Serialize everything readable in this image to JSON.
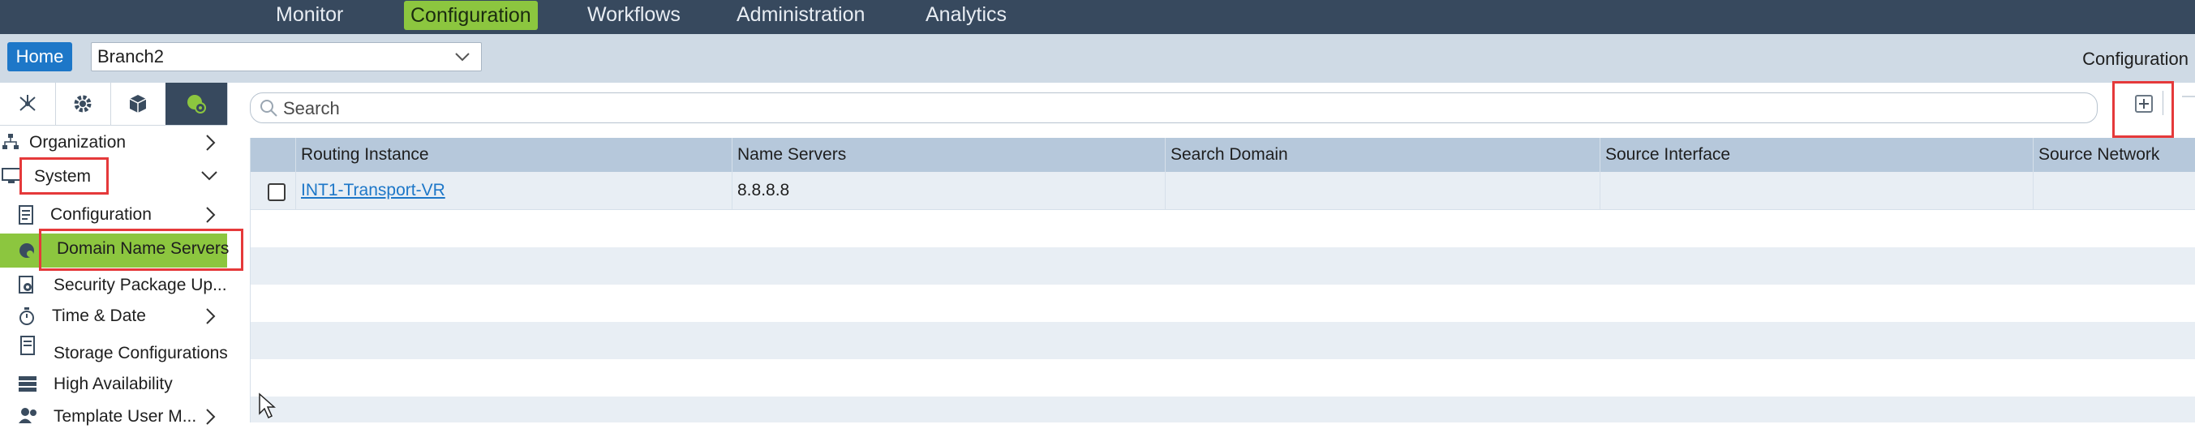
{
  "nav": {
    "items": [
      {
        "label": "Monitor",
        "active": false
      },
      {
        "label": "Configuration",
        "active": true
      },
      {
        "label": "Workflows",
        "active": false
      },
      {
        "label": "Administration",
        "active": false
      },
      {
        "label": "Analytics",
        "active": false
      }
    ]
  },
  "subheader": {
    "home_label": "Home",
    "branch_value": "Branch2",
    "context_label": "Configuration"
  },
  "sidebar": {
    "tabs": [
      "network-icon",
      "gear-icon",
      "cube-icon",
      "globe-gear-icon"
    ],
    "items": [
      {
        "label": "Organization",
        "icon": "org-chart-icon",
        "has_arrow": true,
        "arrow": "right"
      },
      {
        "label": "System",
        "icon": "monitor-icon",
        "has_arrow": true,
        "arrow": "down"
      },
      {
        "label": "Configuration",
        "icon": "document-icon",
        "has_arrow": true,
        "arrow": "right"
      },
      {
        "label": "Domain Name Servers",
        "icon": "globe-icon",
        "has_arrow": false,
        "selected": true
      },
      {
        "label": "Security Package Up...",
        "icon": "shield-gear-icon",
        "has_arrow": false
      },
      {
        "label": "Time & Date",
        "icon": "stopwatch-icon",
        "has_arrow": true,
        "arrow": "right"
      },
      {
        "label": "Storage Configurations",
        "icon": "document-icon",
        "has_arrow": false
      },
      {
        "label": "High Availability",
        "icon": "server-stack-icon",
        "has_arrow": false
      },
      {
        "label": "Template User M...",
        "icon": "users-icon",
        "has_arrow": true,
        "arrow": "right"
      }
    ]
  },
  "content": {
    "search_placeholder": "Search",
    "table": {
      "columns": [
        "Routing Instance",
        "Name Servers",
        "Search Domain",
        "Source Interface",
        "Source Network"
      ],
      "rows": [
        {
          "routing_instance": "INT1-Transport-VR",
          "name_servers": "8.8.8.8",
          "search_domain": "",
          "source_interface": "",
          "source_network": ""
        }
      ]
    }
  },
  "colors": {
    "nav_bg": "#37495e",
    "accent_green": "#8cc63f",
    "home_blue": "#1d77c8",
    "highlight_red": "#e5393a",
    "table_header": "#b6c8db",
    "stripe": "#e8eef4"
  }
}
